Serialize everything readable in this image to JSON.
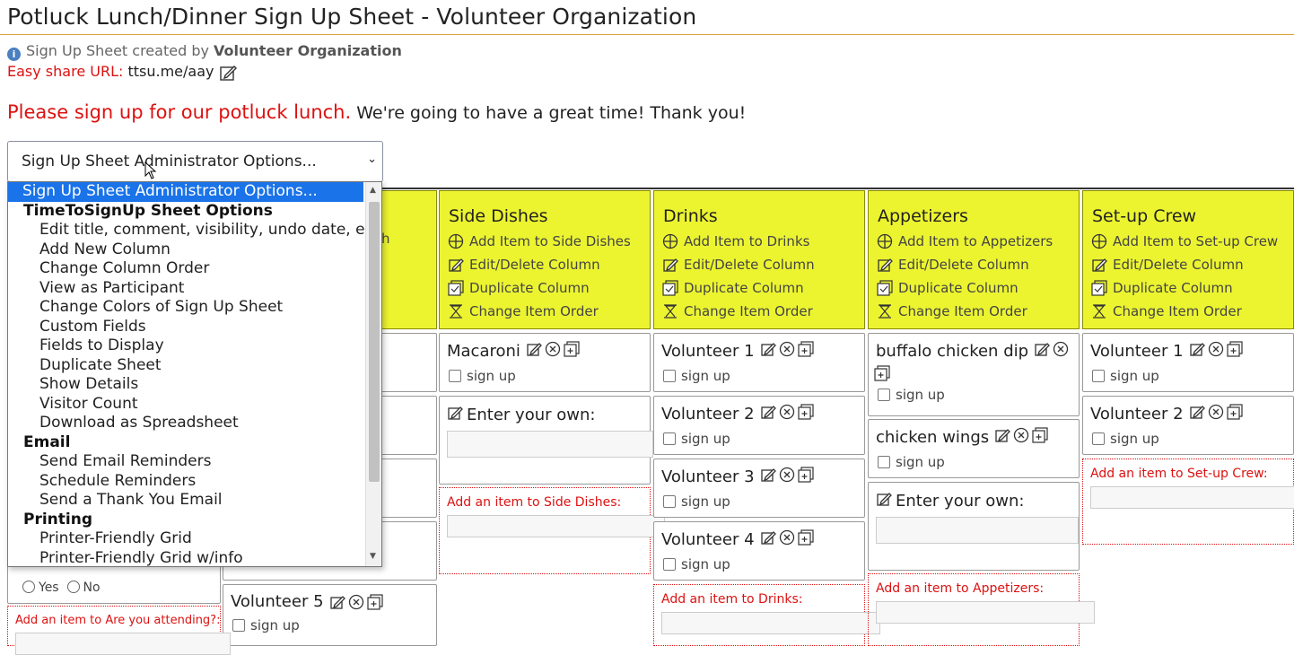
{
  "page_title": "Potluck Lunch/Dinner Sign Up Sheet - Volunteer Organization",
  "created_by": {
    "prefix": "Sign Up Sheet created by",
    "org": "Volunteer Organization"
  },
  "share": {
    "label": "Easy share URL:",
    "url": "ttsu.me/aay"
  },
  "intro": {
    "red": "Please sign up for our potluck lunch.",
    "rest": "We're going to have a great time! Thank you!"
  },
  "admin_select": {
    "value": "Sign Up Sheet Administrator Options..."
  },
  "dropdown": {
    "selected": "Sign Up Sheet Administrator Options...",
    "groups": [
      {
        "label": "TimeToSignUp Sheet Options",
        "items": [
          "Edit title, comment, visibility, undo date, etc",
          "Add New Column",
          "Change Column Order",
          "View as Participant",
          "Change Colors of Sign Up Sheet",
          "Custom Fields",
          "Fields to Display",
          "Duplicate Sheet",
          "Show Details",
          "Visitor Count",
          "Download as Spreadsheet"
        ]
      },
      {
        "label": "Email",
        "items": [
          "Send Email Reminders",
          "Schedule Reminders",
          "Send a Thank You Email"
        ]
      },
      {
        "label": "Printing",
        "items": [
          "Printer-Friendly Grid",
          "Printer-Friendly Grid w/info"
        ]
      }
    ]
  },
  "columns": [
    {
      "title": "Side Dishes",
      "add": "Add Item to Side Dishes",
      "edit": "Edit/Delete Column",
      "dup": "Duplicate Column",
      "order": "Change Item Order",
      "add_item_label": "Add an item to Side Dishes:"
    },
    {
      "title": "Drinks",
      "add": "Add Item to Drinks",
      "edit": "Edit/Delete Column",
      "dup": "Duplicate Column",
      "order": "Change Item Order",
      "add_item_label": "Add an item to Drinks:"
    },
    {
      "title": "Appetizers",
      "add": "Add Item to Appetizers",
      "edit": "Edit/Delete Column",
      "dup": "Duplicate Column",
      "order": "Change Item Order",
      "add_item_label": "Add an item to Appetizers:"
    },
    {
      "title": "Set-up Crew",
      "add": "Add Item to Set-up Crew",
      "edit": "Edit/Delete Column",
      "dup": "Duplicate Column",
      "order": "Change Item Order",
      "add_item_label": "Add an item to Set-up Crew:"
    }
  ],
  "items": {
    "side_dishes": [
      "Macaroni"
    ],
    "drinks": [
      "Volunteer 1",
      "Volunteer 2",
      "Volunteer 3",
      "Volunteer 4"
    ],
    "appetizers": [
      "buffalo chicken dip",
      "chicken wings"
    ],
    "setup": [
      "Volunteer 1",
      "Volunteer 2"
    ],
    "col2_partial": [
      "Volunteer 5"
    ]
  },
  "signup_label": "sign up",
  "enter_own": "Enter your own:",
  "hidden_col_fragment": "h",
  "attending": {
    "yes": "Yes",
    "no": "No",
    "add_label": "Add an item to Are you attending?:"
  },
  "colors": {
    "header_bg": "#ecf430",
    "accent_red": "#dd1111",
    "select_blue": "#1a73e8"
  }
}
